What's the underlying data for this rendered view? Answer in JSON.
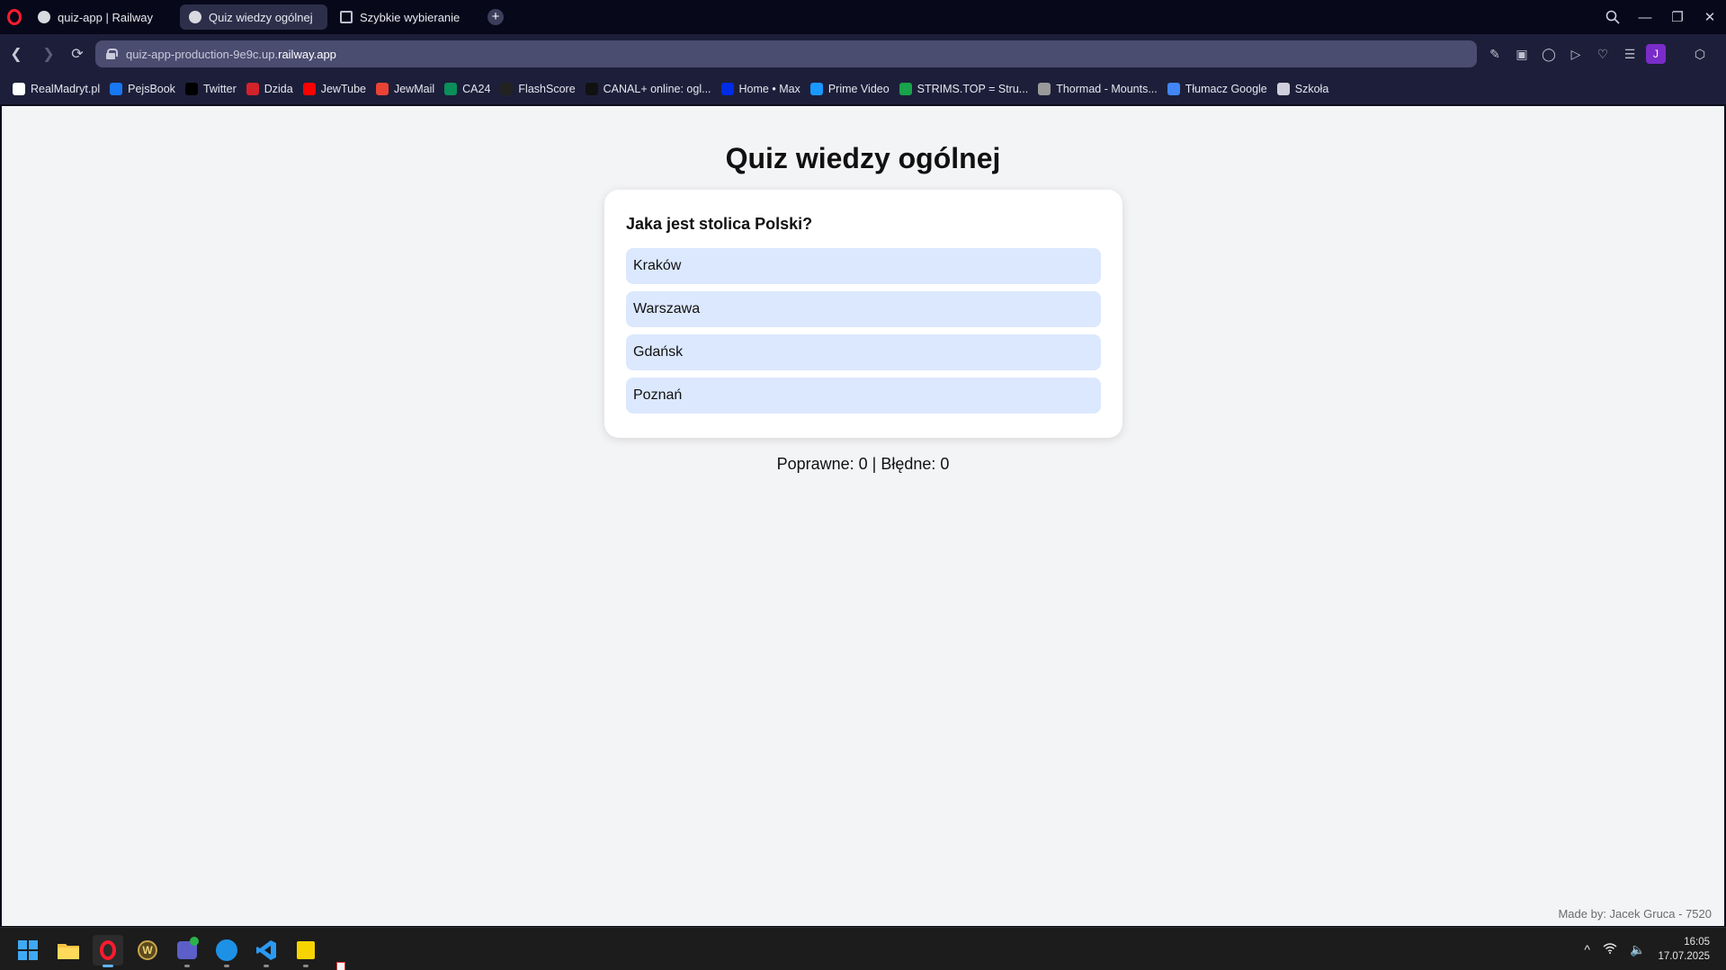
{
  "browser": {
    "tabs": [
      {
        "label": "quiz-app | Railway",
        "active": false
      },
      {
        "label": "Quiz wiedzy ogólnej",
        "active": true
      },
      {
        "label": "Szybkie wybieranie",
        "active": false
      }
    ],
    "new_tab_label": "+",
    "url_prefix": "quiz-app-production-9e9c.up.",
    "url_domain": "railway.app",
    "profile_initial": "J",
    "bookmarks": [
      {
        "label": "RealMadryt.pl",
        "icon": "realmadryt-icon",
        "color": "#ffffff"
      },
      {
        "label": "PejsBook",
        "icon": "facebook-icon",
        "color": "#1877f2"
      },
      {
        "label": "Twitter",
        "icon": "x-icon",
        "color": "#000000"
      },
      {
        "label": "Dzida",
        "icon": "dzida-icon",
        "color": "#d3222a"
      },
      {
        "label": "JewTube",
        "icon": "youtube-icon",
        "color": "#ff0000"
      },
      {
        "label": "JewMail",
        "icon": "gmail-icon",
        "color": "#ea4335"
      },
      {
        "label": "CA24",
        "icon": "ca24-icon",
        "color": "#0a8f5a"
      },
      {
        "label": "FlashScore",
        "icon": "flashscore-icon",
        "color": "#222222"
      },
      {
        "label": "CANAL+ online: ogl...",
        "icon": "canal-icon",
        "color": "#111111"
      },
      {
        "label": "Home • Max",
        "icon": "max-icon",
        "color": "#002be7"
      },
      {
        "label": "Prime Video",
        "icon": "primevideo-icon",
        "color": "#1a98ff"
      },
      {
        "label": "STRIMS.TOP = Stru...",
        "icon": "strims-icon",
        "color": "#19a34a"
      },
      {
        "label": "Thormad - Mounts...",
        "icon": "shield-icon",
        "color": "#9a9a9a"
      },
      {
        "label": "Tłumacz Google",
        "icon": "google-translate-icon",
        "color": "#4285f4"
      },
      {
        "label": "Szkoła",
        "icon": "folder-icon",
        "color": "#cfcfdc"
      }
    ]
  },
  "quiz": {
    "title": "Quiz wiedzy ogólnej",
    "question": "Jaka jest stolica Polski?",
    "answers": [
      "Kraków",
      "Warszawa",
      "Gdańsk",
      "Poznań"
    ],
    "score_text": "Poprawne: 0 | Błędne: 0",
    "footer": "Made by: Jacek Gruca - 7520"
  },
  "taskbar": {
    "time": "16:05",
    "date": "17.07.2025"
  }
}
